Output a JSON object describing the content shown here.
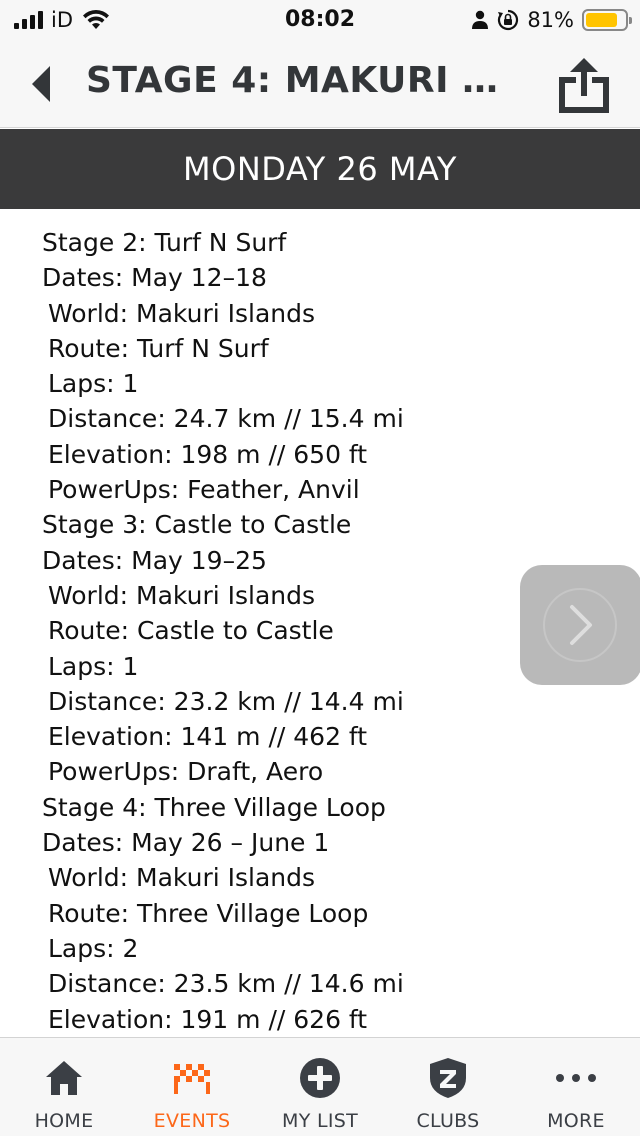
{
  "status_bar": {
    "carrier": "iD",
    "time": "08:02",
    "battery_percent": "81%",
    "battery_level": 0.81,
    "battery_color": "#ffc400"
  },
  "header": {
    "title": "STAGE 4: MAKURI M...",
    "back_icon": "chevron-left-icon",
    "share_icon": "share-icon"
  },
  "date_banner": "MONDAY 26 MAY",
  "details": [
    {
      "text": "Stage 2: Turf N Surf",
      "indent": false
    },
    {
      "text": "Dates: May 12–18",
      "indent": false
    },
    {
      "text": "World: Makuri Islands",
      "indent": true
    },
    {
      "text": "Route: Turf N Surf",
      "indent": true
    },
    {
      "text": "Laps: 1",
      "indent": true
    },
    {
      "text": "Distance: 24.7 km // 15.4 mi",
      "indent": true
    },
    {
      "text": "Elevation: 198 m // 650 ft",
      "indent": true
    },
    {
      "text": "PowerUps: Feather, Anvil",
      "indent": true
    },
    {
      "text": "Stage 3: Castle to Castle",
      "indent": false
    },
    {
      "text": "Dates: May 19–25",
      "indent": false
    },
    {
      "text": "World: Makuri Islands",
      "indent": true
    },
    {
      "text": "Route: Castle to Castle",
      "indent": true
    },
    {
      "text": "Laps: 1",
      "indent": true
    },
    {
      "text": "Distance: 23.2 km // 14.4 mi",
      "indent": true
    },
    {
      "text": "Elevation: 141 m // 462 ft",
      "indent": true
    },
    {
      "text": "PowerUps: Draft, Aero",
      "indent": true
    },
    {
      "text": "Stage 4: Three Village Loop",
      "indent": false
    },
    {
      "text": "Dates: May 26 – June 1",
      "indent": false
    },
    {
      "text": "World: Makuri Islands",
      "indent": true
    },
    {
      "text": "Route: Three Village Loop",
      "indent": true
    },
    {
      "text": "Laps: 2",
      "indent": true
    },
    {
      "text": "Distance: 23.5 km // 14.6 mi",
      "indent": true
    },
    {
      "text": "Elevation: 191 m // 626 ft",
      "indent": true
    }
  ],
  "tabs": [
    {
      "label": "HOME",
      "icon": "home-icon",
      "active": false
    },
    {
      "label": "EVENTS",
      "icon": "checkered-flag-icon",
      "active": true
    },
    {
      "label": "MY LIST",
      "icon": "plus-circle-icon",
      "active": false
    },
    {
      "label": "CLUBS",
      "icon": "shield-icon",
      "active": false
    },
    {
      "label": "MORE",
      "icon": "more-dots-icon",
      "active": false
    }
  ],
  "colors": {
    "accent": "#fc6719",
    "banner_bg": "#3a3a3b",
    "header_text": "#333639",
    "tab_inactive": "#3b3f45"
  }
}
